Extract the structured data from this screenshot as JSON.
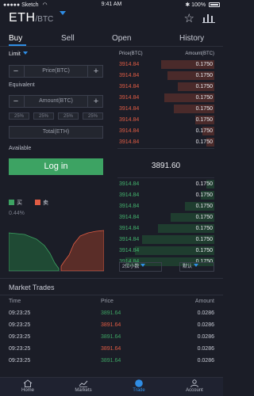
{
  "status_bar": {
    "carrier": "Sketch",
    "time": "9:41 AM",
    "battery": "100%"
  },
  "header": {
    "base": "ETH",
    "quote": "/BTC"
  },
  "tabs": [
    {
      "label": "Buy"
    },
    {
      "label": "Sell"
    },
    {
      "label": "Open"
    },
    {
      "label": "History"
    }
  ],
  "order_form": {
    "order_type": "Limit",
    "price_placeholder": "Price(BTC)",
    "equivalent_label": "Equivalent",
    "amount_placeholder": "Amount(BTC)",
    "percent_buttons": [
      "25%",
      "25%",
      "25%",
      "25%"
    ],
    "total_placeholder": "Total(ETH)",
    "available_label": "Available",
    "submit_label": "Log in",
    "minus": "−",
    "plus": "+"
  },
  "order_book": {
    "price_header": "Price(BTC)",
    "amount_header": "Amount(BTC)",
    "asks": [
      {
        "price": "3914.84",
        "amount": "0.1750",
        "depth": 0.55
      },
      {
        "price": "3914.84",
        "amount": "0.1750",
        "depth": 0.48
      },
      {
        "price": "3914.84",
        "amount": "0.1750",
        "depth": 0.38
      },
      {
        "price": "3914.84",
        "amount": "0.1750",
        "depth": 0.52
      },
      {
        "price": "3914.84",
        "amount": "0.1750",
        "depth": 0.42
      },
      {
        "price": "3914.84",
        "amount": "0.1750",
        "depth": 0.2
      },
      {
        "price": "3914.84",
        "amount": "0.1750",
        "depth": 0.12
      },
      {
        "price": "3914.84",
        "amount": "0.1750",
        "depth": 0.08
      }
    ],
    "last_price": "3891.60",
    "bids": [
      {
        "price": "3914.84",
        "amount": "0.1750",
        "depth": 0.08
      },
      {
        "price": "3914.84",
        "amount": "0.1750",
        "depth": 0.14
      },
      {
        "price": "3914.84",
        "amount": "0.1750",
        "depth": 0.3
      },
      {
        "price": "3914.84",
        "amount": "0.1750",
        "depth": 0.45
      },
      {
        "price": "3914.84",
        "amount": "0.1750",
        "depth": 0.58
      },
      {
        "price": "3914.84",
        "amount": "0.1750",
        "depth": 0.75
      },
      {
        "price": "3914.84",
        "amount": "0.1750",
        "depth": 0.82
      },
      {
        "price": "3914.84",
        "amount": "0.1750",
        "depth": 0.92
      }
    ],
    "decimals_select": "2位小数",
    "default_select": "默认"
  },
  "depth_chart": {
    "buy_label": "买",
    "sell_label": "卖",
    "change": "0.44%",
    "buy_color": "#3da363",
    "sell_color": "#e05c44"
  },
  "market_trades": {
    "title": "Market Trades",
    "headers": {
      "time": "Time",
      "price": "Price",
      "amount": "Amount"
    },
    "rows": [
      {
        "time": "09:23:25",
        "price": "3891.64",
        "amount": "0.0286",
        "side": "buy"
      },
      {
        "time": "09:23:25",
        "price": "3891.64",
        "amount": "0.0286",
        "side": "sell"
      },
      {
        "time": "09:23:25",
        "price": "3891.64",
        "amount": "0.0286",
        "side": "buy"
      },
      {
        "time": "09:23:25",
        "price": "3891.64",
        "amount": "0.0286",
        "side": "sell"
      },
      {
        "time": "09:23:25",
        "price": "3891.64",
        "amount": "0.0286",
        "side": "buy"
      }
    ]
  },
  "nav": [
    {
      "label": "Home",
      "icon": "home-icon"
    },
    {
      "label": "Markets",
      "icon": "markets-icon"
    },
    {
      "label": "Trade",
      "icon": "trade-icon",
      "active": true
    },
    {
      "label": "Account",
      "icon": "account-icon"
    }
  ],
  "colors": {
    "accent": "#2f8de4",
    "buy": "#3da363",
    "sell": "#e05c44",
    "background": "#1b1d27"
  }
}
